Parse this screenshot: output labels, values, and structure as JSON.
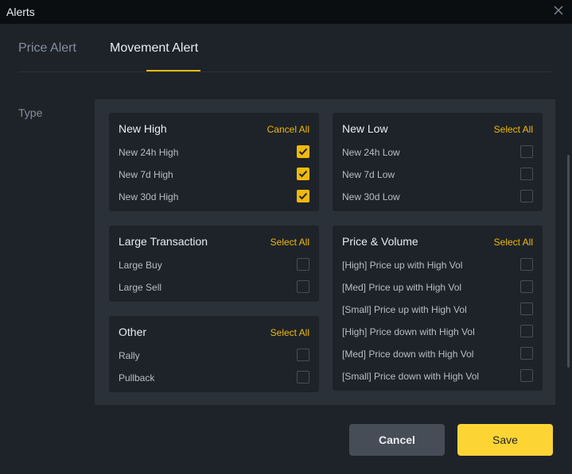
{
  "window": {
    "title": "Alerts"
  },
  "tabs": [
    {
      "label": "Price Alert",
      "active": false
    },
    {
      "label": "Movement Alert",
      "active": true
    }
  ],
  "type_label": "Type",
  "colors": {
    "accent": "#f0b90b",
    "save_bg": "#fcd535",
    "panel_bg": "#2b3139",
    "card_bg": "#1e2329"
  },
  "groups": {
    "new_high": {
      "title": "New High",
      "action": "Cancel All",
      "items": [
        {
          "label": "New 24h High",
          "checked": true
        },
        {
          "label": "New 7d High",
          "checked": true
        },
        {
          "label": "New 30d High",
          "checked": true
        }
      ]
    },
    "new_low": {
      "title": "New Low",
      "action": "Select All",
      "items": [
        {
          "label": "New 24h Low",
          "checked": false
        },
        {
          "label": "New 7d Low",
          "checked": false
        },
        {
          "label": "New 30d Low",
          "checked": false
        }
      ]
    },
    "large_transaction": {
      "title": "Large Transaction",
      "action": "Select All",
      "items": [
        {
          "label": "Large Buy",
          "checked": false
        },
        {
          "label": "Large Sell",
          "checked": false
        }
      ]
    },
    "price_volume": {
      "title": "Price & Volume",
      "action": "Select All",
      "items": [
        {
          "label": "[High] Price up with High Vol",
          "checked": false
        },
        {
          "label": "[Med] Price up with High Vol",
          "checked": false
        },
        {
          "label": "[Small] Price up with High Vol",
          "checked": false
        },
        {
          "label": "[High] Price down with High Vol",
          "checked": false
        },
        {
          "label": "[Med] Price down with High Vol",
          "checked": false
        },
        {
          "label": "[Small] Price down with High Vol",
          "checked": false
        }
      ]
    },
    "other": {
      "title": "Other",
      "action": "Select All",
      "items": [
        {
          "label": "Rally",
          "checked": false
        },
        {
          "label": "Pullback",
          "checked": false
        }
      ]
    }
  },
  "buttons": {
    "cancel": "Cancel",
    "save": "Save"
  }
}
